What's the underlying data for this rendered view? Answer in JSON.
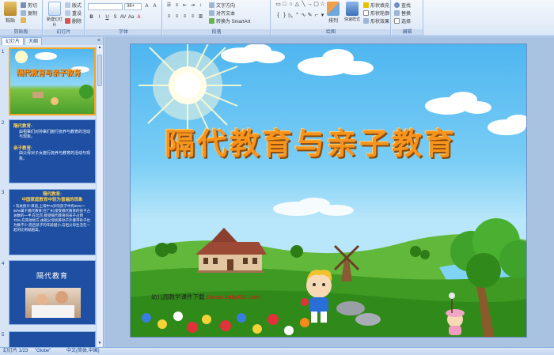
{
  "ribbon": {
    "clipboard": {
      "paste": "粘贴",
      "cut": "剪切",
      "copy": "复制",
      "format_painter": "格式刷",
      "group": "剪贴板"
    },
    "slides": {
      "new_slide": "新建幻灯片",
      "layout": "版式",
      "reset": "重设",
      "delete": "删除",
      "group": "幻灯片"
    },
    "font": {
      "font_name": "",
      "font_size": "36+",
      "group": "字体"
    },
    "paragraph": {
      "text_direction": "文字方向",
      "align_text": "对齐文本",
      "smartart": "转换为 SmartArt",
      "group": "段落"
    },
    "drawing": {
      "arrange": "排列",
      "quick_styles": "快速样式",
      "shape_fill": "形状填充",
      "shape_outline": "形状轮廓",
      "shape_effects": "形状效果",
      "group": "绘图"
    },
    "editing": {
      "find": "查找",
      "replace": "替换",
      "select": "选择",
      "group": "编辑"
    }
  },
  "pane": {
    "tab_slides": "幻灯片",
    "tab_outline": "大纲",
    "close": "×",
    "thumbs": [
      {
        "num": "1",
        "title": "隔代教育与亲子教育"
      },
      {
        "num": "2",
        "h1": "隔代教育:",
        "b1": "由祖辈们对孙辈们施行抚养与教育的活动与现象。",
        "h2": "亲子教育:",
        "b2": "由父母对子女施行抚养与教育的活动与现象。"
      },
      {
        "num": "3",
        "h1": "隔代教育:",
        "h2": "中国家庭教育中较为普遍的现象",
        "b1": "• 有关统计:目前,上海中-6岁的孩子中有50%～60%属于隔代教育;在广州,接受隔代教育的孩子占总数的一半;在北京,接受隔代教育的孩子占到70%;在其他地方,由祖父母抚养孙子外婆带孙子也为数不少,而且孩子的年龄越小,与祖父母生活在一起的比例就越高。"
      },
      {
        "num": "4",
        "title": "隔代教育"
      },
      {
        "num": "5"
      }
    ]
  },
  "slide": {
    "title": "隔代教育与亲子教育",
    "watermark_text": "幼儿园教学课件下载",
    "watermark_url": "ziyuan.baby611.com"
  },
  "status": {
    "slide_pos": "幻灯片 1/23",
    "theme": "\"Globe\"",
    "language": "中文(简体,中国)"
  },
  "colors": {
    "title_orange": "#f7941d",
    "ribbon_blue": "#dbe7f7",
    "slide_sky": "#4fb6f0",
    "thumb_blue": "#1e4fa3"
  }
}
